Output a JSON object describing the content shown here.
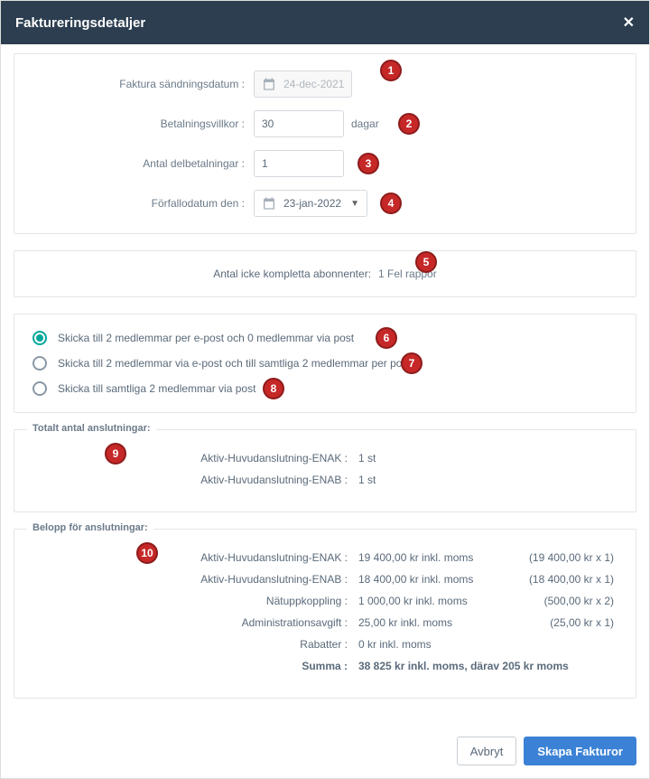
{
  "modal": {
    "title": "Faktureringsdetaljer"
  },
  "form": {
    "sendDate": {
      "label": "Faktura sändningsdatum :",
      "value": "24-dec-2021"
    },
    "terms": {
      "label": "Betalningsvillkor :",
      "value": "30",
      "unit": "dagar"
    },
    "partials": {
      "label": "Antal delbetalningar :",
      "value": "1"
    },
    "dueDate": {
      "label": "Förfallodatum den :",
      "value": "23-jan-2022"
    }
  },
  "incomplete": {
    "label": "Antal icke kompletta abonnenter:",
    "link": "1 Fel rappor"
  },
  "delivery": {
    "opt1": "Skicka till 2 medlemmar per e-post och 0 medlemmar via post",
    "opt2": "Skicka till 2 medlemmar via e-post och till samtliga 2 medlemmar per post",
    "opt3": "Skicka till samtliga 2 medlemmar via post"
  },
  "connections": {
    "legend": "Totalt antal anslutningar:",
    "rows": [
      {
        "k": "Aktiv-Huvudanslutning-ENAK :",
        "v": "1 st"
      },
      {
        "k": "Aktiv-Huvudanslutning-ENAB :",
        "v": "1 st"
      }
    ]
  },
  "amounts": {
    "legend": "Belopp för anslutningar:",
    "rows": [
      {
        "k": "Aktiv-Huvudanslutning-ENAK :",
        "v1": "19 400,00 kr inkl. moms",
        "v2": "(19 400,00 kr x 1)"
      },
      {
        "k": "Aktiv-Huvudanslutning-ENAB :",
        "v1": "18 400,00 kr inkl. moms",
        "v2": "(18 400,00 kr x 1)"
      },
      {
        "k": "Nätuppkoppling :",
        "v1": "1 000,00 kr inkl. moms",
        "v2": "(500,00 kr x 2)"
      },
      {
        "k": "Administrationsavgift :",
        "v1": "25,00 kr inkl. moms",
        "v2": "(25,00 kr x 1)"
      }
    ],
    "discount": {
      "k": "Rabatter :",
      "v": "0 kr inkl. moms"
    },
    "sum": {
      "k": "Summa :",
      "v": "38 825 kr inkl. moms, därav 205 kr moms"
    }
  },
  "footer": {
    "cancel": "Avbryt",
    "create": "Skapa Fakturor"
  },
  "annotations": [
    "1",
    "2",
    "3",
    "4",
    "5",
    "6",
    "7",
    "8",
    "9",
    "10"
  ]
}
